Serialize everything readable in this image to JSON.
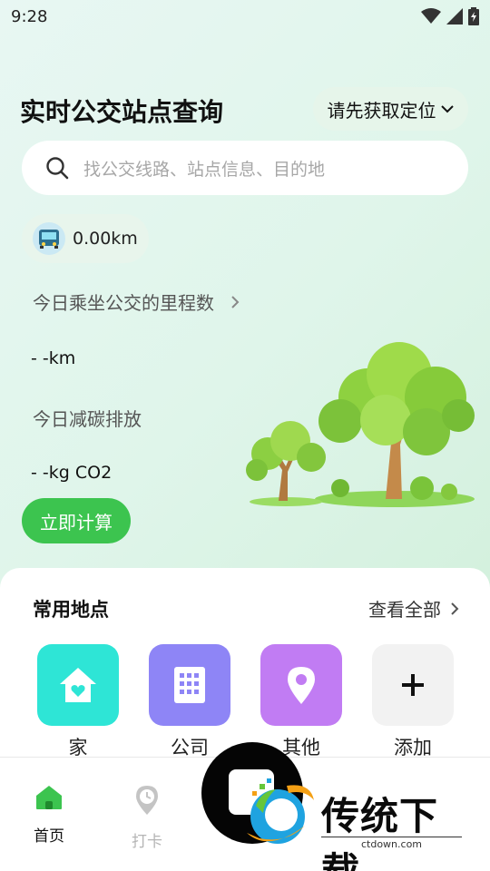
{
  "status_bar": {
    "time": "9:28"
  },
  "header": {
    "title": "实时公交站点查询",
    "location_button": "请先获取定位"
  },
  "search": {
    "placeholder": "找公交线路、站点信息、目的地"
  },
  "stats": {
    "distance_chip": "0.00km",
    "mileage_label": "今日乘坐公交的里程数",
    "mileage_value": "- -km",
    "carbon_label": "今日减碳排放",
    "carbon_value": "- -kg CO2",
    "calculate_button": "立即计算"
  },
  "favorites": {
    "title": "常用地点",
    "view_all": "查看全部",
    "places": [
      {
        "label": "家",
        "icon": "home-icon",
        "color": "#2ee5d6"
      },
      {
        "label": "公司",
        "icon": "building-icon",
        "color": "#8e85f6"
      },
      {
        "label": "其他",
        "icon": "location-pin-icon",
        "color": "#c17cf3"
      },
      {
        "label": "添加",
        "icon": "plus-icon",
        "color": "#f2f2f2"
      }
    ]
  },
  "tabbar": {
    "tabs": [
      {
        "label": "首页",
        "icon": "home-icon",
        "active": true
      },
      {
        "label": "打卡",
        "icon": "clock-pin-icon",
        "active": false
      }
    ]
  },
  "watermark": {
    "brand": "传统下载",
    "url": "ctdown.com"
  },
  "colors": {
    "accent_green": "#3cc44f",
    "inactive_gray": "#b5b5b5"
  }
}
